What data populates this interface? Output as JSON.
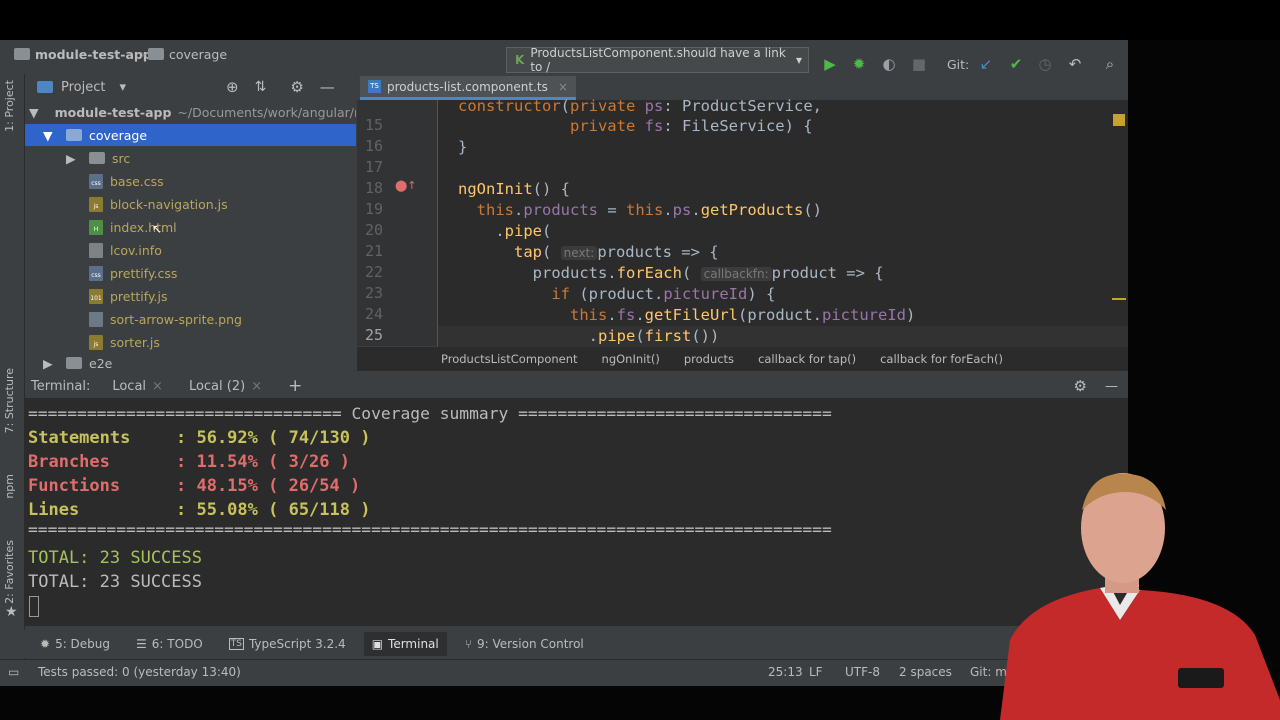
{
  "navbar": {
    "project": "module-test-app",
    "folder": "coverage",
    "run_config": "ProductsListComponent.should have a link to /",
    "git_label": "Git:"
  },
  "project_panel": {
    "title": "Project",
    "tree": [
      {
        "label": "module-test-app",
        "path": "~/Documents/work/angular/m"
      },
      {
        "label": "coverage"
      },
      {
        "label": "src"
      },
      {
        "label": "base.css"
      },
      {
        "label": "block-navigation.js"
      },
      {
        "label": "index.html"
      },
      {
        "label": "lcov.info"
      },
      {
        "label": "prettify.css"
      },
      {
        "label": "prettify.js"
      },
      {
        "label": "sort-arrow-sprite.png"
      },
      {
        "label": "sorter.js"
      },
      {
        "label": "e2e"
      }
    ]
  },
  "side_tabs": [
    "1: Project",
    "7: Structure",
    "npm",
    "2: Favorites"
  ],
  "editor": {
    "tab": "products-list.component.ts",
    "line_numbers": [
      "15",
      "16",
      "17",
      "18",
      "19",
      "20",
      "21",
      "22",
      "23",
      "24",
      "25"
    ],
    "hints": {
      "next": "next:",
      "callbackfn": "callbackfn:"
    },
    "breadcrumbs": [
      "ProductsListComponent",
      "ngOnInit()",
      "products",
      "callback for tap()",
      "callback for forEach()"
    ]
  },
  "terminal": {
    "title": "Terminal:",
    "tabs": [
      "Local",
      "Local (2)"
    ],
    "summary_line": "================================ Coverage summary ================================",
    "separator": "==================================================================================",
    "stats": [
      {
        "label": "Statements",
        "value": ": 56.92% ( 74/130 )"
      },
      {
        "label": "Branches",
        "value": ": 11.54% ( 3/26 )"
      },
      {
        "label": "Functions",
        "value": ": 48.15% ( 26/54 )"
      },
      {
        "label": "Lines",
        "value": ": 55.08% ( 65/118 )"
      }
    ],
    "totals": [
      "TOTAL: 23 SUCCESS",
      "TOTAL: 23 SUCCESS"
    ]
  },
  "bottom_tabs": [
    "5: Debug",
    "6: TODO",
    "TypeScript 3.2.4",
    "Terminal",
    "9: Version Control"
  ],
  "status": {
    "message": "Tests passed: 0 (yesterday 13:40)",
    "position": "25:13",
    "line_sep": "LF",
    "encoding": "UTF-8",
    "indent": "2 spaces",
    "git": "Git: mast"
  },
  "colors": {
    "stat_yellow": "#c8c25a",
    "stat_red": "#e06c6c",
    "success_green": "#a5c25c",
    "selection": "#2f65ca"
  }
}
